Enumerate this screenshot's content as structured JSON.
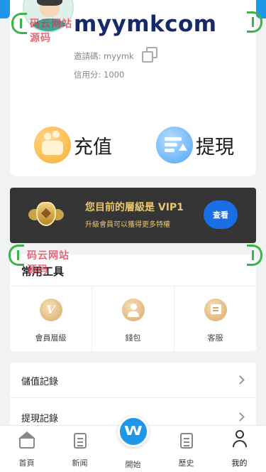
{
  "profile": {
    "username": "myymkcom",
    "invite_code_label": "邀請碼: myymk",
    "credit_label": "信用分: 1000"
  },
  "actions": {
    "recharge_label": "充值",
    "withdraw_label": "提現"
  },
  "vip": {
    "title": "您目前的層級是 VIP1",
    "subtitle": "升級會員可以獲得更多特權",
    "view_button": "查看"
  },
  "tools": {
    "title": "常用工具",
    "items": [
      {
        "label": "會員層級",
        "icon": "vip-level-icon"
      },
      {
        "label": "錢包",
        "icon": "wallet-person-icon"
      },
      {
        "label": "客服",
        "icon": "customer-service-icon"
      }
    ]
  },
  "records": {
    "items": [
      {
        "label": "儲值記錄"
      },
      {
        "label": "提現記錄"
      }
    ]
  },
  "tabbar": {
    "items": [
      {
        "label": "首頁",
        "icon": "home-icon"
      },
      {
        "label": "新闻",
        "icon": "news-icon"
      },
      {
        "label": "開始",
        "icon": "start-icon"
      },
      {
        "label": "歷史",
        "icon": "history-icon"
      },
      {
        "label": "我的",
        "icon": "profile-icon"
      }
    ],
    "active": "我的"
  },
  "watermark": {
    "text": "码云网站源码"
  },
  "colors": {
    "brand_blue": "#1f97e8",
    "username": "#152a66",
    "vip_gold": "#e9c66d",
    "vip_button": "#1a6fe6",
    "banner_bg": "#353535"
  }
}
